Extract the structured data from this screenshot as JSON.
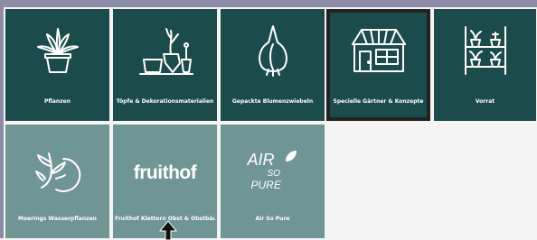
{
  "tiles_row1": [
    {
      "label": "Pflanzen",
      "icon": "potted-plant-icon"
    },
    {
      "label": "Töpfe & Dekorationsmaterialien",
      "icon": "pots-icon"
    },
    {
      "label": "Gepackte Blumenzwiebeln",
      "icon": "bulb-icon"
    },
    {
      "label": "Specielle Gärtner & Konzepte",
      "icon": "greenhouse-icon"
    },
    {
      "label": "Vorrat",
      "icon": "shelf-icon"
    }
  ],
  "tiles_row2": [
    {
      "label": "Moerings Wasserpflanzen",
      "icon": "water-plant-icon"
    },
    {
      "label": "Fruithof Klettern Obst & Obstbäume",
      "icon": "fruithof-logo",
      "logo_text": "fruithof"
    },
    {
      "label": "Air So Pure",
      "icon": "air-so-pure-logo",
      "logo_line1": "AIR",
      "logo_line2": "SO",
      "logo_line3": "PURE"
    }
  ],
  "colors": {
    "tile_dark": "#1c4b4b",
    "tile_light": "#6f9594",
    "selected_border": "#222222"
  }
}
